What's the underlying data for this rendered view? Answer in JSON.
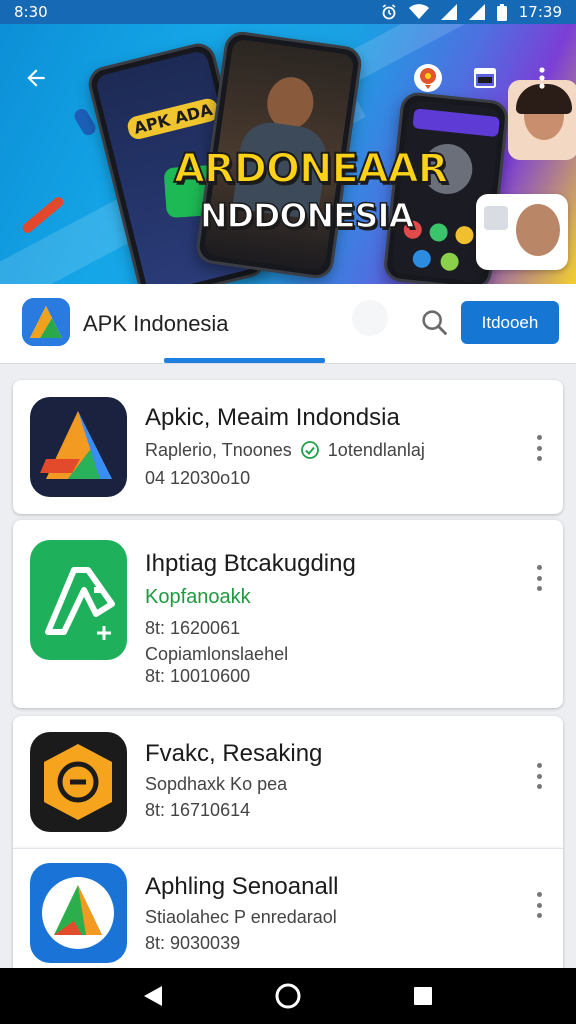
{
  "status_bar": {
    "time_left": "8:30",
    "time_right": "17:39"
  },
  "banner": {
    "title": "ARDONEAAR",
    "subtitle": "NDDONESIA",
    "phone_logo_text": "APK ADA",
    "colors": {
      "accent_yellow": "#ffd21a",
      "sky": "#15a6e8",
      "purple": "#7b3fd6"
    }
  },
  "toolbar": {
    "back_icon": "arrow-back-icon",
    "icons": [
      "notification-badge-icon",
      "window-icon",
      "more-vert-icon"
    ]
  },
  "app_bar": {
    "title": "APK Indonesia",
    "search_icon": "search-icon",
    "cta_label": "Itdooeh"
  },
  "apps": [
    {
      "name": "Apkic, Meaim Indondsia",
      "line1_before": "Raplerio, Tnoones",
      "line1_after": "1otendlanlaj",
      "line2": "04 12030o10",
      "line3": "",
      "line1_green": false,
      "verified": true
    },
    {
      "name": "Ihptiag Btcakugding",
      "line1_before": "Kopfanoakk",
      "line1_after": "",
      "line2": "8t: 1620061",
      "line3": "Copiamlonslaehel",
      "line4": "8t: 10010600",
      "line1_green": true,
      "verified": false
    },
    {
      "name": "Fvakc, Resaking",
      "line1_before": "Sopdhaxk Ko pea",
      "line1_after": "",
      "line2": "8t: 16710614",
      "line3": "",
      "line1_green": false,
      "verified": false
    },
    {
      "name": "Aphling Senoanall",
      "line1_before": "Stiaolahec P enredaraol",
      "line1_after": "",
      "line2": "8t: 9030039",
      "line3": "",
      "line1_green": false,
      "verified": false
    }
  ],
  "nav_bar": {
    "icons": [
      "back-triangle-icon",
      "home-circle-icon",
      "recents-square-icon"
    ]
  }
}
